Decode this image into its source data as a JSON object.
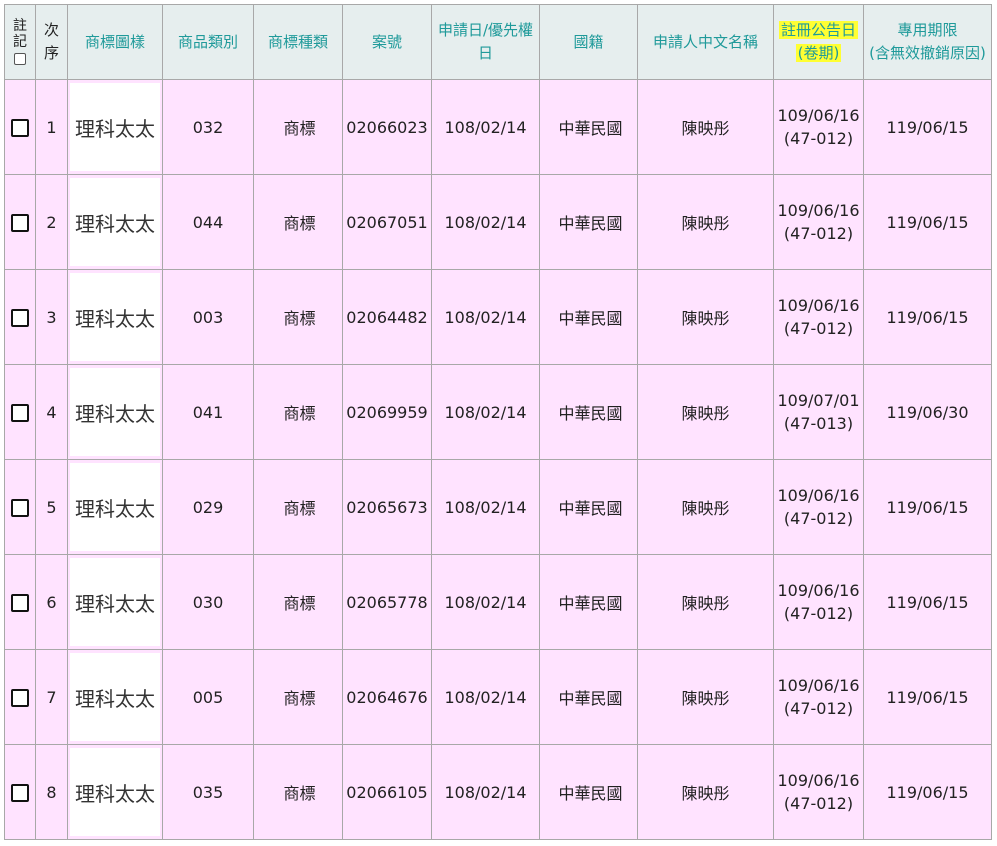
{
  "headers": {
    "mark_line1": "註",
    "mark_line2": "記",
    "seq_line1": "次",
    "seq_line2": "序",
    "logo": "商標圖樣",
    "goods_class": "商品類別",
    "mark_type": "商標種類",
    "case_no": "案號",
    "filing_date_line1": "申請日/優先權",
    "filing_date_line2": "日",
    "country": "國籍",
    "applicant": "申請人中文名稱",
    "reg_pub_line1": "註冊公告日",
    "reg_pub_line2": "(卷期)",
    "term_line1": "專用期限",
    "term_line2": "(含無效撤銷原因)"
  },
  "colors": {
    "header_bg": "#e6eeee",
    "header_text": "#1f9a9a",
    "row_bg": "#ffe3ff",
    "applicant_text": "#e0001a",
    "highlight": "#ffff33"
  },
  "rows": [
    {
      "seq": "1",
      "logo_text": "理科太太",
      "goods_class": "032",
      "mark_type": "商標",
      "case_no": "02066023",
      "filing_date": "108/02/14",
      "country": "中華民國",
      "applicant": "陳映彤",
      "reg_date": "109/06/16",
      "reg_vol": "(47-012)",
      "term": "119/06/15"
    },
    {
      "seq": "2",
      "logo_text": "理科太太",
      "goods_class": "044",
      "mark_type": "商標",
      "case_no": "02067051",
      "filing_date": "108/02/14",
      "country": "中華民國",
      "applicant": "陳映彤",
      "reg_date": "109/06/16",
      "reg_vol": "(47-012)",
      "term": "119/06/15"
    },
    {
      "seq": "3",
      "logo_text": "理科太太",
      "goods_class": "003",
      "mark_type": "商標",
      "case_no": "02064482",
      "filing_date": "108/02/14",
      "country": "中華民國",
      "applicant": "陳映彤",
      "reg_date": "109/06/16",
      "reg_vol": "(47-012)",
      "term": "119/06/15"
    },
    {
      "seq": "4",
      "logo_text": "理科太太",
      "goods_class": "041",
      "mark_type": "商標",
      "case_no": "02069959",
      "filing_date": "108/02/14",
      "country": "中華民國",
      "applicant": "陳映彤",
      "reg_date": "109/07/01",
      "reg_vol": "(47-013)",
      "term": "119/06/30"
    },
    {
      "seq": "5",
      "logo_text": "理科太太",
      "goods_class": "029",
      "mark_type": "商標",
      "case_no": "02065673",
      "filing_date": "108/02/14",
      "country": "中華民國",
      "applicant": "陳映彤",
      "reg_date": "109/06/16",
      "reg_vol": "(47-012)",
      "term": "119/06/15"
    },
    {
      "seq": "6",
      "logo_text": "理科太太",
      "goods_class": "030",
      "mark_type": "商標",
      "case_no": "02065778",
      "filing_date": "108/02/14",
      "country": "中華民國",
      "applicant": "陳映彤",
      "reg_date": "109/06/16",
      "reg_vol": "(47-012)",
      "term": "119/06/15"
    },
    {
      "seq": "7",
      "logo_text": "理科太太",
      "goods_class": "005",
      "mark_type": "商標",
      "case_no": "02064676",
      "filing_date": "108/02/14",
      "country": "中華民國",
      "applicant": "陳映彤",
      "reg_date": "109/06/16",
      "reg_vol": "(47-012)",
      "term": "119/06/15"
    },
    {
      "seq": "8",
      "logo_text": "理科太太",
      "goods_class": "035",
      "mark_type": "商標",
      "case_no": "02066105",
      "filing_date": "108/02/14",
      "country": "中華民國",
      "applicant": "陳映彤",
      "reg_date": "109/06/16",
      "reg_vol": "(47-012)",
      "term": "119/06/15"
    }
  ]
}
